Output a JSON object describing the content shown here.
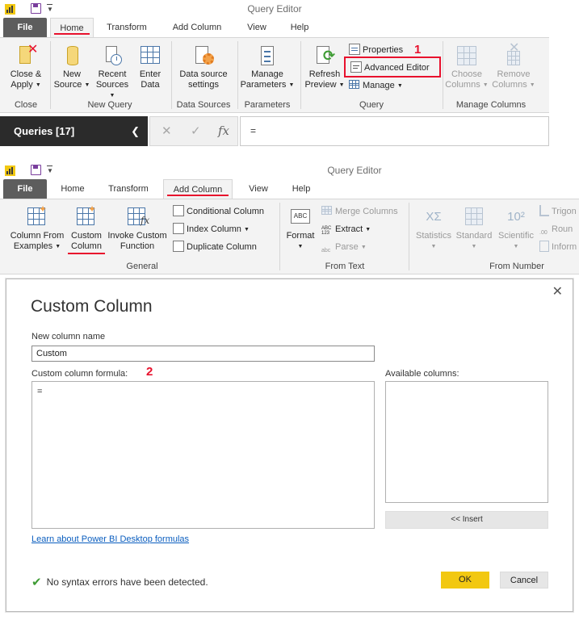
{
  "screenshot1": {
    "title": "Query Editor",
    "tabs": [
      "File",
      "Home",
      "Transform",
      "Add Column",
      "View",
      "Help"
    ],
    "ribbon": {
      "close_apply": [
        "Close &",
        "Apply"
      ],
      "new_source": [
        "New",
        "Source"
      ],
      "recent_sources": [
        "Recent",
        "Sources"
      ],
      "enter_data": [
        "Enter",
        "Data"
      ],
      "data_source_settings": [
        "Data source",
        "settings"
      ],
      "manage_parameters": [
        "Manage",
        "Parameters"
      ],
      "refresh_preview": [
        "Refresh",
        "Preview"
      ],
      "properties": "Properties",
      "advanced_editor": "Advanced Editor",
      "manage": "Manage",
      "choose_columns": [
        "Choose",
        "Columns"
      ],
      "remove_columns": [
        "Remove",
        "Columns"
      ],
      "groups": [
        "Close",
        "New Query",
        "Data Sources",
        "Parameters",
        "Query",
        "Manage Columns"
      ]
    },
    "annotation_number": "1",
    "queries_label": "Queries [17]",
    "formula_value": "="
  },
  "screenshot2": {
    "title": "Query Editor",
    "tabs": [
      "File",
      "Home",
      "Transform",
      "Add Column",
      "View",
      "Help"
    ],
    "ribbon": {
      "column_from_examples": [
        "Column From",
        "Examples"
      ],
      "custom_column": [
        "Custom",
        "Column"
      ],
      "invoke_custom_function": [
        "Invoke Custom",
        "Function"
      ],
      "conditional_column": "Conditional Column",
      "index_column": "Index Column",
      "duplicate_column": "Duplicate Column",
      "format": "Format",
      "format_icon_text": "ABC",
      "merge_columns": "Merge Columns",
      "extract": "Extract",
      "extract_icon_text": [
        "ABC",
        "123"
      ],
      "parse": "Parse",
      "parse_icon_text": "abc",
      "statistics": "Statistics",
      "statistics_icon_text": "XΣ",
      "standard": "Standard",
      "scientific": "Scientific",
      "scientific_icon_text": "10²",
      "trig": "Trigon",
      "round": "Roun",
      "info": "Inform",
      "groups": [
        "General",
        "From Text",
        "From Number"
      ]
    }
  },
  "dialog": {
    "title": "Custom Column",
    "new_column_name_label": "New column name",
    "new_column_name_value": "Custom",
    "formula_label": "Custom column formula:",
    "annotation_number": "2",
    "formula_value": "=",
    "available_columns_label": "Available columns:",
    "insert_label": "<< Insert",
    "learn_link": "Learn about Power BI Desktop formulas",
    "status": "No syntax errors have been detected.",
    "ok_label": "OK",
    "cancel_label": "Cancel"
  },
  "colors": {
    "annotation_red": "#e8112d",
    "ok_yellow": "#f2c811",
    "dark_query_bar": "#2b2b2b",
    "link_blue": "#0b5ebf"
  },
  "icons": [
    "power-bi-icon",
    "save-icon",
    "close-apply-icon",
    "new-source-icon",
    "recent-sources-icon",
    "enter-data-icon",
    "data-source-settings-icon",
    "manage-parameters-icon",
    "refresh-icon",
    "properties-icon",
    "advanced-editor-icon",
    "manage-icon",
    "choose-columns-icon",
    "remove-columns-icon",
    "cancel-x-icon",
    "commit-check-icon",
    "fx-icon",
    "chevron-left-icon",
    "close-icon",
    "check-icon"
  ]
}
